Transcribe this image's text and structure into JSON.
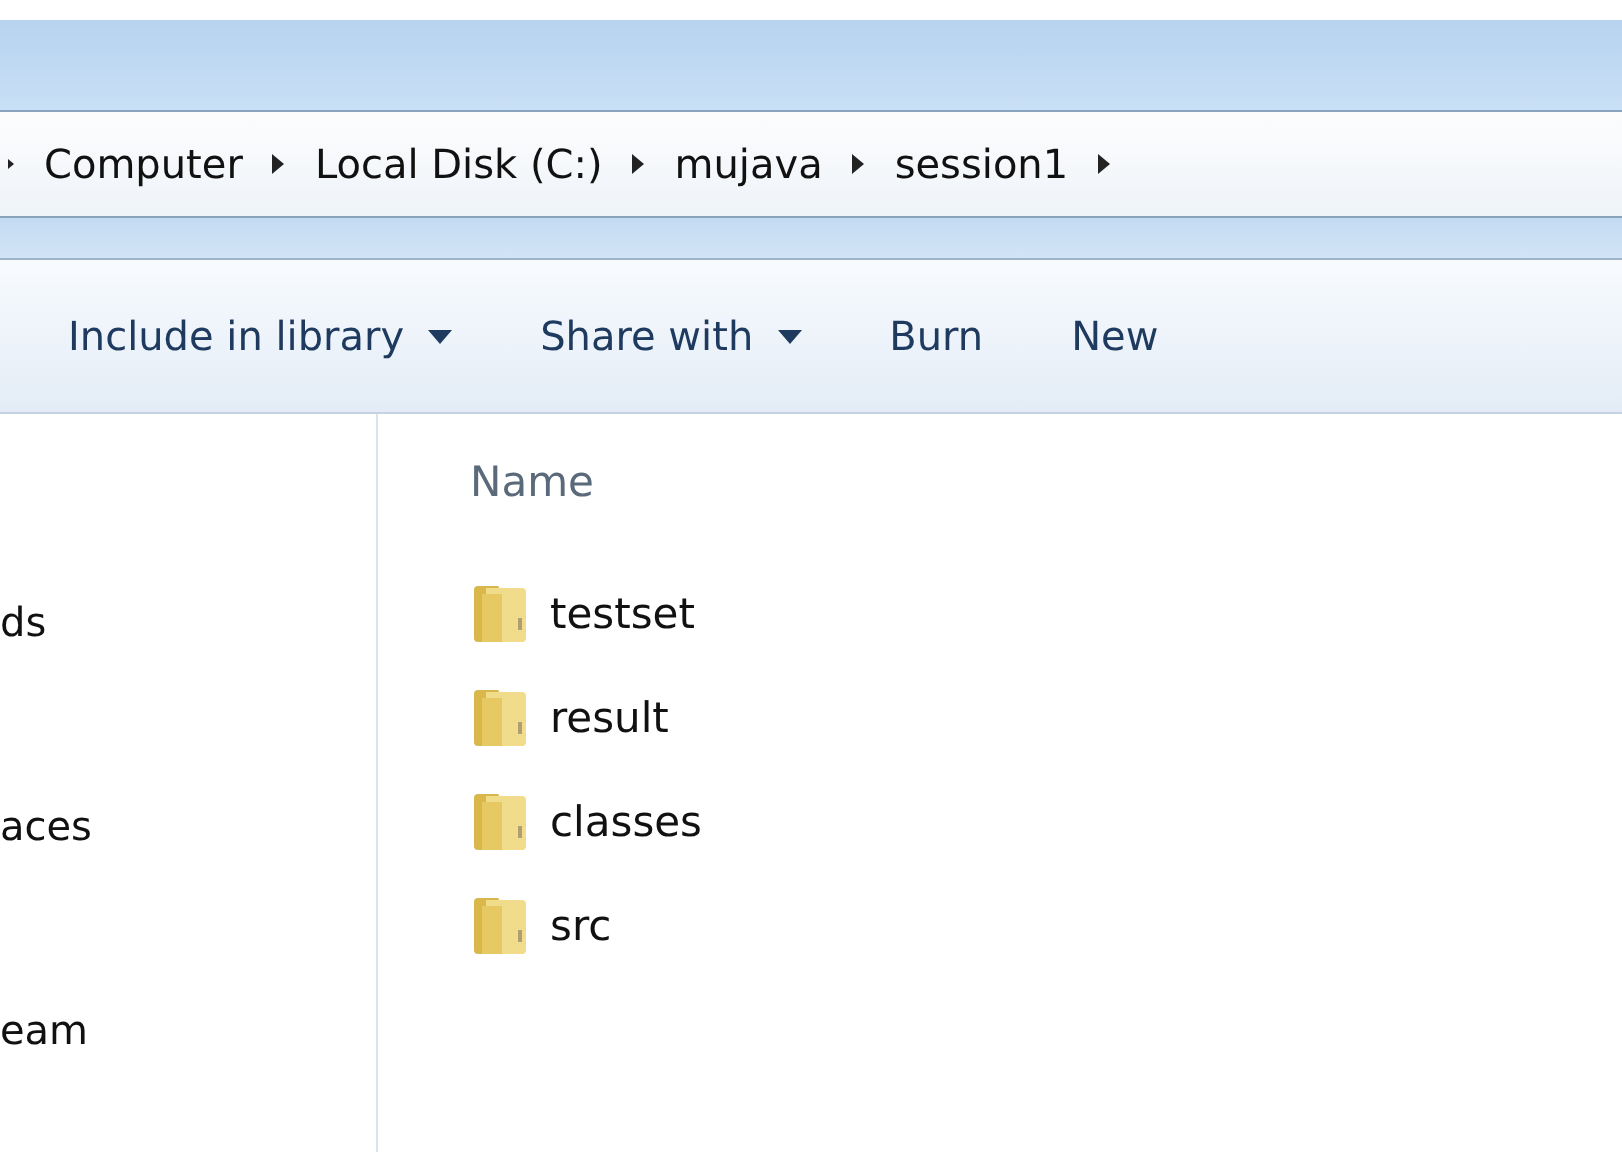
{
  "breadcrumbs": [
    "Computer",
    "Local Disk (C:)",
    "mujava",
    "session1"
  ],
  "toolbar": [
    {
      "label": "Include in library",
      "dropdown": true
    },
    {
      "label": "Share with",
      "dropdown": true
    },
    {
      "label": "Burn",
      "dropdown": false
    },
    {
      "label": "New",
      "dropdown": false
    }
  ],
  "sidebar": {
    "items": [
      "ds",
      "aces",
      "eam"
    ]
  },
  "file_list": {
    "column": "Name",
    "items": [
      "testset",
      "result",
      "classes",
      "src"
    ]
  }
}
